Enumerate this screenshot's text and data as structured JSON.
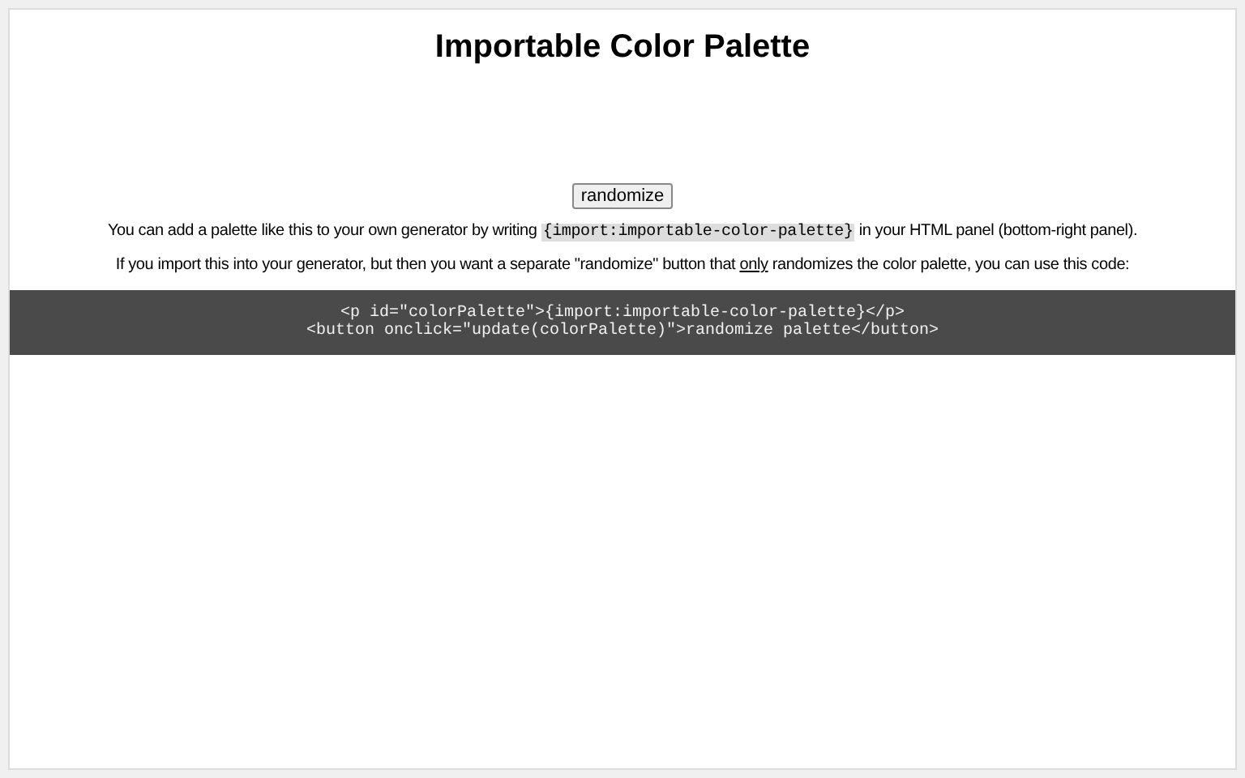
{
  "title": "Importable Color Palette",
  "button": {
    "label": "randomize"
  },
  "paragraphs": [
    [
      {
        "kind": "text",
        "text": "You can add a palette like this to your own generator by writing "
      },
      {
        "kind": "code",
        "text": "{import:importable-color-palette}"
      },
      {
        "kind": "text",
        "text": " in your HTML panel (bottom-right panel)."
      }
    ],
    [
      {
        "kind": "text",
        "text": "If you import this into your generator, but then you want a separate \"randomize\" button that "
      },
      {
        "kind": "underline",
        "text": "only"
      },
      {
        "kind": "text",
        "text": " randomizes the color palette, you can use this code:"
      }
    ]
  ],
  "code_lines": [
    "<p id=\"colorPalette\">{import:importable-color-palette}</p>",
    "<button onclick=\"update(colorPalette)\">randomize palette</button>"
  ]
}
